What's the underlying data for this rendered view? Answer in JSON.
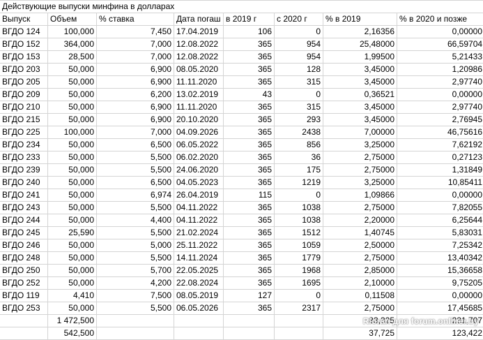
{
  "title": "Действующие выпуски минфина в долларах",
  "headers": [
    "Выпуск",
    "Объем",
    "% ставка",
    "",
    "Дата погаш",
    "в 2019 г",
    "с 2020 г",
    "% в 2019",
    "% в 2020 и позже"
  ],
  "rows": [
    {
      "issue": "ВГДО 124",
      "volume": "100,000",
      "rate": "7,450",
      "maturity": "17.04.2019",
      "days2019": "106",
      "days2020": "0",
      "pct2019": "2,16356",
      "pct2020": "0,00000"
    },
    {
      "issue": "ВГДО 152",
      "volume": "364,000",
      "rate": "7,000",
      "maturity": "12.08.2022",
      "days2019": "365",
      "days2020": "954",
      "pct2019": "25,48000",
      "pct2020": "66,59704"
    },
    {
      "issue": "ВГДО 153",
      "volume": "28,500",
      "rate": "7,000",
      "maturity": "12.08.2022",
      "days2019": "365",
      "days2020": "954",
      "pct2019": "1,99500",
      "pct2020": "5,21433"
    },
    {
      "issue": "ВГДО 203",
      "volume": "50,000",
      "rate": "6,900",
      "maturity": "08.05.2020",
      "days2019": "365",
      "days2020": "128",
      "pct2019": "3,45000",
      "pct2020": "1,20986"
    },
    {
      "issue": "ВГДО 205",
      "volume": "50,000",
      "rate": "6,900",
      "maturity": "11.11.2020",
      "days2019": "365",
      "days2020": "315",
      "pct2019": "3,45000",
      "pct2020": "2,97740"
    },
    {
      "issue": "ВГДО 209",
      "volume": "50,000",
      "rate": "6,200",
      "maturity": "13.02.2019",
      "days2019": "43",
      "days2020": "0",
      "pct2019": "0,36521",
      "pct2020": "0,00000"
    },
    {
      "issue": "ВГДО 210",
      "volume": "50,000",
      "rate": "6,900",
      "maturity": "11.11.2020",
      "days2019": "365",
      "days2020": "315",
      "pct2019": "3,45000",
      "pct2020": "2,97740"
    },
    {
      "issue": "ВГДО 215",
      "volume": "50,000",
      "rate": "6,900",
      "maturity": "20.10.2020",
      "days2019": "365",
      "days2020": "293",
      "pct2019": "3,45000",
      "pct2020": "2,76945"
    },
    {
      "issue": "ВГДО 225",
      "volume": "100,000",
      "rate": "7,000",
      "maturity": "04.09.2026",
      "days2019": "365",
      "days2020": "2438",
      "pct2019": "7,00000",
      "pct2020": "46,75616"
    },
    {
      "issue": "ВГДО 234",
      "volume": "50,000",
      "rate": "6,500",
      "maturity": "06.05.2022",
      "days2019": "365",
      "days2020": "856",
      "pct2019": "3,25000",
      "pct2020": "7,62192"
    },
    {
      "issue": "ВГДО 233",
      "volume": "50,000",
      "rate": "5,500",
      "maturity": "06.02.2020",
      "days2019": "365",
      "days2020": "36",
      "pct2019": "2,75000",
      "pct2020": "0,27123"
    },
    {
      "issue": "ВГДО 239",
      "volume": "50,000",
      "rate": "5,500",
      "maturity": "24.06.2020",
      "days2019": "365",
      "days2020": "175",
      "pct2019": "2,75000",
      "pct2020": "1,31849"
    },
    {
      "issue": "ВГДО 240",
      "volume": "50,000",
      "rate": "6,500",
      "maturity": "04.05.2023",
      "days2019": "365",
      "days2020": "1219",
      "pct2019": "3,25000",
      "pct2020": "10,85411"
    },
    {
      "issue": "ВГДО 241",
      "volume": "50,000",
      "rate": "6,974",
      "maturity": "26.04.2019",
      "days2019": "115",
      "days2020": "0",
      "pct2019": "1,09866",
      "pct2020": "0,00000"
    },
    {
      "issue": "ВГДО 243",
      "volume": "50,000",
      "rate": "5,500",
      "maturity": "04.11.2022",
      "days2019": "365",
      "days2020": "1038",
      "pct2019": "2,75000",
      "pct2020": "7,82055"
    },
    {
      "issue": "ВГДО 244",
      "volume": "50,000",
      "rate": "4,400",
      "maturity": "04.11.2022",
      "days2019": "365",
      "days2020": "1038",
      "pct2019": "2,20000",
      "pct2020": "6,25644"
    },
    {
      "issue": "ВГДО 245",
      "volume": "25,590",
      "rate": "5,500",
      "maturity": "21.02.2024",
      "days2019": "365",
      "days2020": "1512",
      "pct2019": "1,40745",
      "pct2020": "5,83031"
    },
    {
      "issue": "ВГДО 246",
      "volume": "50,000",
      "rate": "5,000",
      "maturity": "25.11.2022",
      "days2019": "365",
      "days2020": "1059",
      "pct2019": "2,50000",
      "pct2020": "7,25342"
    },
    {
      "issue": "ВГДО 248",
      "volume": "50,000",
      "rate": "5,500",
      "maturity": "14.11.2024",
      "days2019": "365",
      "days2020": "1779",
      "pct2019": "2,75000",
      "pct2020": "13,40342"
    },
    {
      "issue": "ВГДО 250",
      "volume": "50,000",
      "rate": "5,700",
      "maturity": "22.05.2025",
      "days2019": "365",
      "days2020": "1968",
      "pct2019": "2,85000",
      "pct2020": "15,36658"
    },
    {
      "issue": "ВГДО 252",
      "volume": "50,000",
      "rate": "4,200",
      "maturity": "22.08.2024",
      "days2019": "365",
      "days2020": "1695",
      "pct2019": "2,10000",
      "pct2020": "9,75205"
    },
    {
      "issue": "ВГДО 119",
      "volume": "4,410",
      "rate": "7,500",
      "maturity": "08.05.2019",
      "days2019": "127",
      "days2020": "0",
      "pct2019": "0,11508",
      "pct2020": "0,00000"
    },
    {
      "issue": "ВГДО 253",
      "volume": "50,000",
      "rate": "5,500",
      "maturity": "06.05.2026",
      "days2019": "365",
      "days2020": "2317",
      "pct2019": "2,75000",
      "pct2020": "17,45685"
    }
  ],
  "totals": [
    {
      "volume": "1 472,500",
      "pct2019": "83,325",
      "pct2020": "231,707"
    },
    {
      "volume": "542,500",
      "pct2019": "37,725",
      "pct2020": "123,422"
    }
  ],
  "watermark": "Rloran для forum.onliner.by"
}
